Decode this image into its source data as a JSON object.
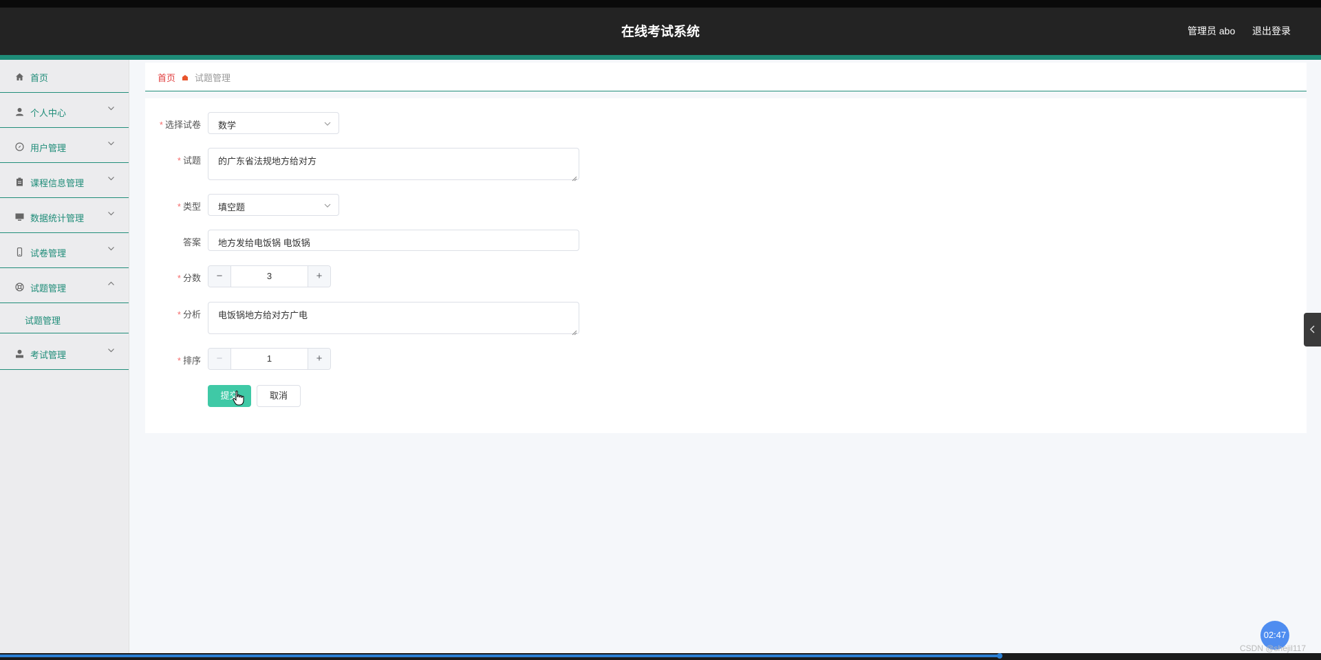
{
  "header": {
    "title": "在线考试系统",
    "user": "管理员 abo",
    "logout": "退出登录"
  },
  "sidebar": {
    "items": [
      {
        "label": "首页",
        "icon": "home-icon"
      },
      {
        "label": "个人中心",
        "icon": "person-icon"
      },
      {
        "label": "用户管理",
        "icon": "compass-icon"
      },
      {
        "label": "课程信息管理",
        "icon": "clipboard-icon"
      },
      {
        "label": "数据统计管理",
        "icon": "monitor-icon"
      },
      {
        "label": "试卷管理",
        "icon": "phone-icon"
      },
      {
        "label": "试题管理",
        "icon": "help-icon"
      },
      {
        "label": "考试管理",
        "icon": "user-icon"
      }
    ],
    "submenu": {
      "label": "试题管理"
    }
  },
  "breadcrumb": {
    "home": "首页",
    "current": "试题管理"
  },
  "form": {
    "paper": {
      "label": "选择试卷",
      "value": "数学"
    },
    "question": {
      "label": "试题",
      "value": "的广东省法规地方给对方"
    },
    "type": {
      "label": "类型",
      "value": "填空题"
    },
    "answer": {
      "label": "答案",
      "value": "地方发给电饭锅 电饭锅"
    },
    "score": {
      "label": "分数",
      "value": "3"
    },
    "analysis": {
      "label": "分析",
      "value": "电饭锅地方给对方广电"
    },
    "order": {
      "label": "排序",
      "value": "1"
    },
    "required_mark": "*",
    "submit": "提交",
    "cancel": "取消"
  },
  "overlay": {
    "timer": "02:47",
    "watermark": "CSDN @shejil117",
    "video_progress": 0.757
  },
  "colors": {
    "accent": "#1e8c78",
    "submit": "#3fc9a6",
    "breadcrumb_home": "#e03d3d",
    "required": "#f56c6c"
  }
}
